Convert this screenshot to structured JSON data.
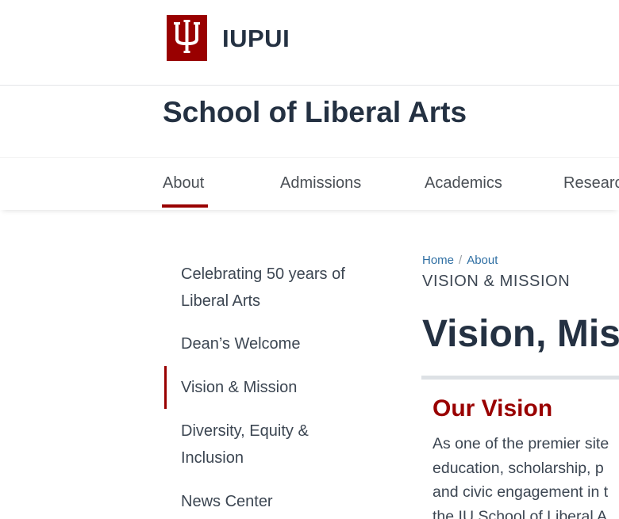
{
  "brand": {
    "logo_alt": "IU trident",
    "name": "IUPUI",
    "logo_color": "#990000"
  },
  "site": {
    "title": "School of Liberal Arts"
  },
  "nav": {
    "items": [
      {
        "label": "About",
        "active": true
      },
      {
        "label": "Admissions"
      },
      {
        "label": "Academics"
      },
      {
        "label": "Researc"
      }
    ],
    "accent_color": "#990000"
  },
  "sidebar": {
    "items": [
      {
        "label": "Celebrating 50 years of Liberal Arts"
      },
      {
        "label": "Dean’s Welcome"
      },
      {
        "label": "Vision & Mission",
        "active": true
      },
      {
        "label": "Diversity, Equity & Inclusion"
      },
      {
        "label": "News Center"
      }
    ]
  },
  "breadcrumb": {
    "home": "Home",
    "separator": "/",
    "current": "About"
  },
  "main": {
    "section_label": "VISION & MISSION",
    "page_title": "Vision, Miss",
    "vision": {
      "heading": "Our Vision",
      "lines": [
        "As one of the premier site",
        "education, scholarship, p",
        "and civic engagement in t",
        "the IU School of Liberal A"
      ]
    }
  }
}
